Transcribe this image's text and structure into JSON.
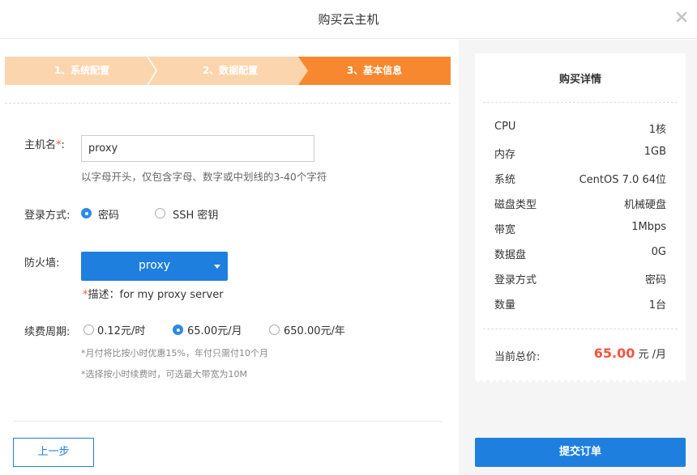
{
  "dialog": {
    "title": "购买云主机",
    "close_icon": "close-icon"
  },
  "steps": [
    {
      "label": "1、系统配置",
      "state": "done"
    },
    {
      "label": "2、数据配置",
      "state": "done"
    },
    {
      "label": "3、基本信息",
      "state": "active"
    }
  ],
  "form": {
    "hostname": {
      "label": "主机名",
      "required_mark": "*",
      "colon": ":",
      "value": "proxy",
      "hint": "以字母开头，仅包含字母、数字或中划线的3-40个字符"
    },
    "login": {
      "label": "登录方式:",
      "options": [
        {
          "label": "密码",
          "checked": true
        },
        {
          "label": "SSH 密钥",
          "checked": false
        }
      ]
    },
    "firewall": {
      "label": "防火墙:",
      "selected": "proxy",
      "desc_mark": "*",
      "desc": "描述：for my proxy server"
    },
    "billing": {
      "label": "续费周期:",
      "options": [
        {
          "label": "0.12元/时",
          "checked": false
        },
        {
          "label": "65.00元/月",
          "checked": true
        },
        {
          "label": "650.00元/年",
          "checked": false
        }
      ],
      "note1": "*月付将比按小时优惠15%，年付只需付10个月",
      "note2": "*选择按小时续费时，可选最大带宽为10M"
    }
  },
  "buttons": {
    "prev": "上一步",
    "submit": "提交订单"
  },
  "summary": {
    "title": "购买详情",
    "rows": [
      {
        "key": "CPU",
        "value": "1核"
      },
      {
        "key": "内存",
        "value": "1GB"
      },
      {
        "key": "系统",
        "value": "CentOS 7.0 64位"
      },
      {
        "key": "磁盘类型",
        "value": "机械硬盘"
      },
      {
        "key": "带宽",
        "value": "1Mbps"
      },
      {
        "key": "数据盘",
        "value": "0G"
      },
      {
        "key": "登录方式",
        "value": "密码"
      },
      {
        "key": "数量",
        "value": "1台"
      }
    ],
    "total_label": "当前总价:",
    "total_amount": "65.00",
    "total_unit": " 元 /月"
  },
  "colors": {
    "accent": "#1e7fdf",
    "step_active": "#f7882f",
    "step_done": "#fbd5ad",
    "price": "#f5533d"
  }
}
